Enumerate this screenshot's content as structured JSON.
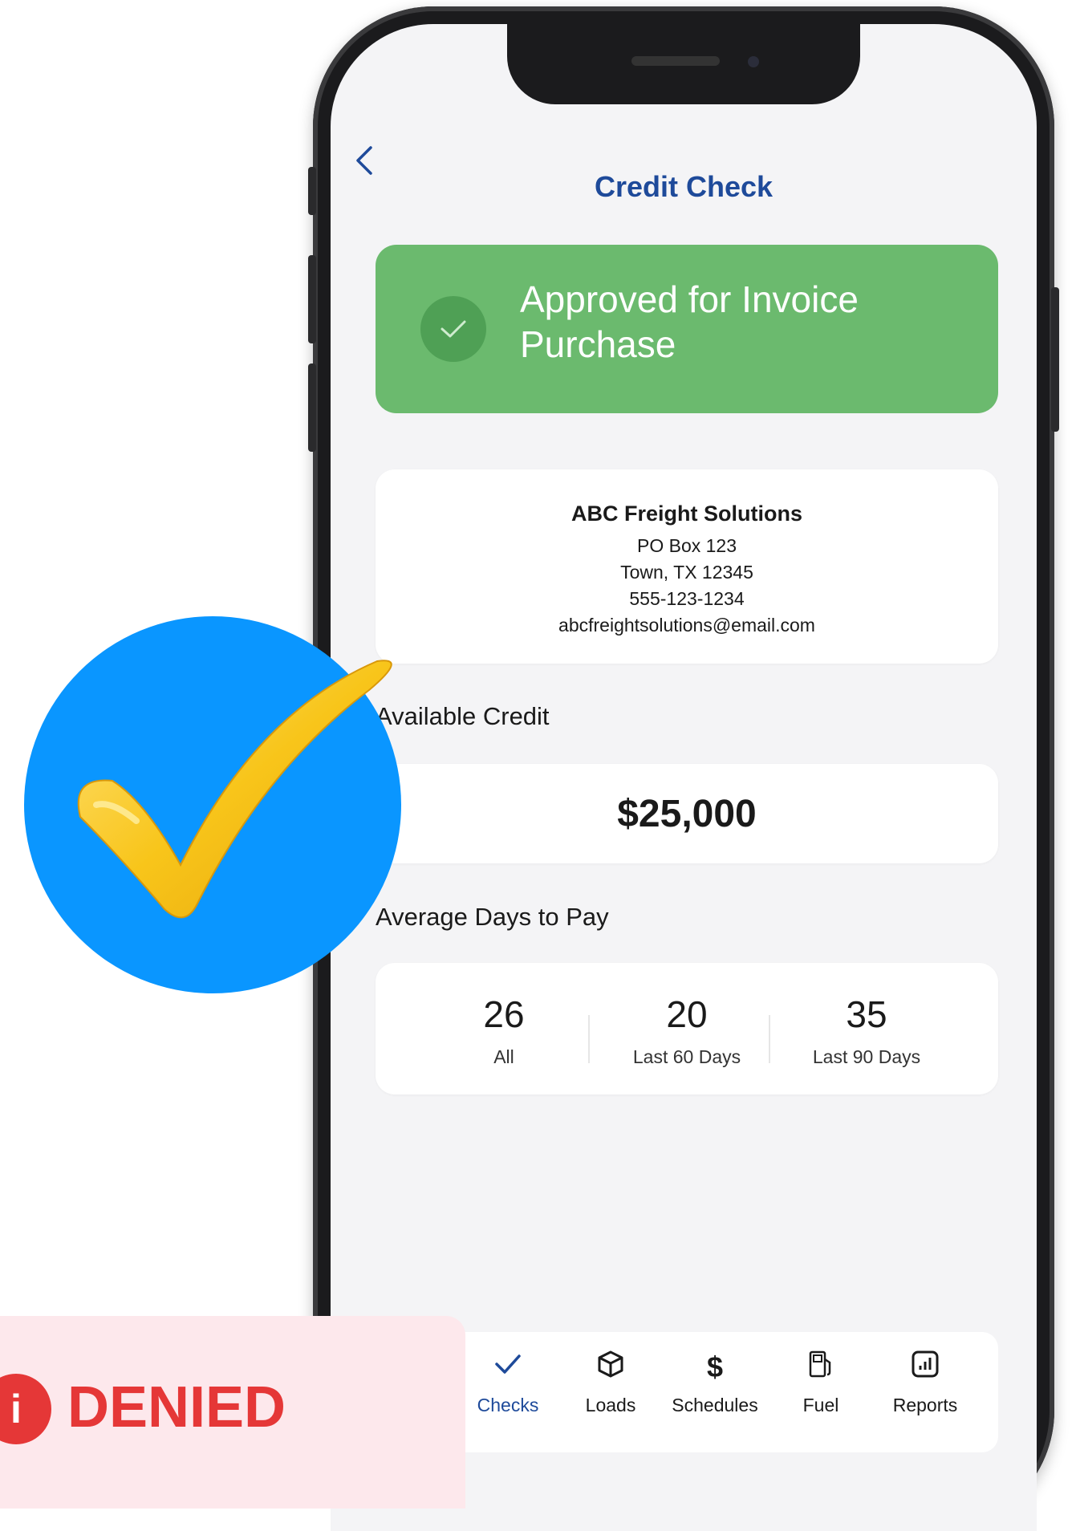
{
  "header": {
    "title": "Credit Check",
    "back_icon": "chevron-left-icon"
  },
  "status": {
    "message": "Approved for Invoice Purchase",
    "icon": "check-circle-icon",
    "color": "#6bba6e"
  },
  "company": {
    "name": "ABC Freight Solutions",
    "address_line1": "PO Box 123",
    "address_line2": "Town, TX 12345",
    "phone": "555-123-1234",
    "email": "abcfreightsolutions@email.com"
  },
  "available_credit": {
    "label": "Available Credit",
    "value": "$25,000"
  },
  "days_to_pay": {
    "label": "Average Days to Pay",
    "stats": [
      {
        "value": "26",
        "label": "All"
      },
      {
        "value": "20",
        "label": "Last 60 Days"
      },
      {
        "value": "35",
        "label": "Last 90 Days"
      }
    ]
  },
  "nav": [
    {
      "label": "Checks",
      "icon": "check-icon",
      "active": true
    },
    {
      "label": "Loads",
      "icon": "box-icon"
    },
    {
      "label": "Schedules",
      "icon": "dollar-icon"
    },
    {
      "label": "Fuel",
      "icon": "fuel-pump-icon"
    },
    {
      "label": "Reports",
      "icon": "bar-chart-icon"
    }
  ],
  "denied_banner": {
    "text": "DENIED",
    "icon": "info-icon",
    "color": "#e53737"
  },
  "overlay": {
    "icon": "checkmark-badge-icon",
    "circle_color": "#0a96ff",
    "check_color": "#f5c21f"
  }
}
